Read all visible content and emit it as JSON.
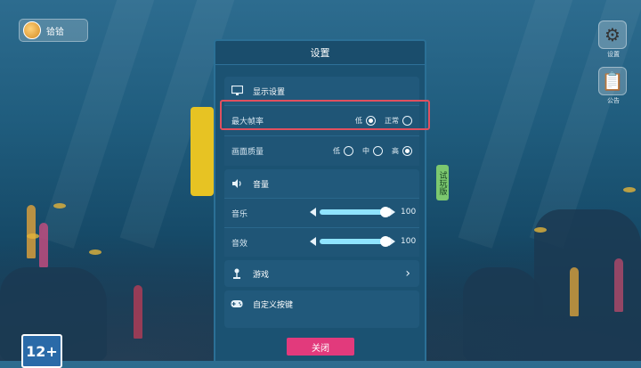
{
  "user": {
    "name": "铪铪"
  },
  "side_buttons": [
    {
      "label": "设置",
      "icon": "gear-icon"
    },
    {
      "label": "公告",
      "icon": "notes-icon"
    }
  ],
  "rating": "12+",
  "trial_tag": "试玩版",
  "dialog": {
    "title": "设置",
    "display_section": {
      "title": "显示设置",
      "icon": "monitor-icon",
      "max_fps": {
        "label": "最大帧率",
        "options": [
          "低",
          "正常"
        ],
        "selected": "低"
      },
      "quality": {
        "label": "画面质量",
        "options": [
          "低",
          "中",
          "高"
        ],
        "selected": "高"
      }
    },
    "audio_section": {
      "title": "音量",
      "icon": "speaker-icon",
      "music": {
        "label": "音乐",
        "value": "100",
        "fraction": 1.0
      },
      "sfx": {
        "label": "音效",
        "value": "100",
        "fraction": 1.0
      }
    },
    "game_section": {
      "title": "游戏",
      "icon": "joystick-icon"
    },
    "keys_section": {
      "title": "自定义按键",
      "icon": "gamepad-icon"
    },
    "close_label": "关闭"
  },
  "colors": {
    "highlight": "#e0505f",
    "close_button": "#e23a7c",
    "slider_fill": "#8fe4ff"
  }
}
